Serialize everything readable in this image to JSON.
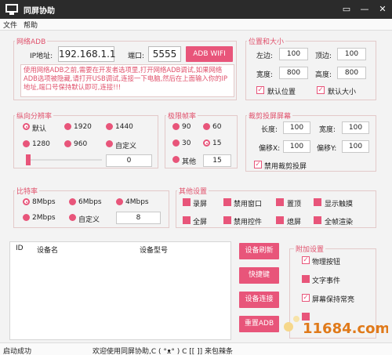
{
  "window": {
    "title": "同屏协助",
    "btn_pin": "▭",
    "btn_min": "—",
    "btn_close": "✕"
  },
  "menu": [
    "文件",
    "帮助"
  ],
  "adb": {
    "title": "网络ADB",
    "ip_label": "IP地址:",
    "ip_value": "192.168.1.1",
    "port_label": "端口:",
    "port_value": "5555",
    "button": "ADB WIFI",
    "notice": "使用网络ADB之前,需要在开发者选项里,打开网络ADB调试,如果网络ADB选项被隐藏,请打开USB调试,连接一下电脑,然后在上面输入你的IP地址,端口号保持默认即可,连接!!!"
  },
  "position": {
    "title": "位置和大小",
    "left_label": "左边:",
    "left_value": "100",
    "top_label": "顶边:",
    "top_value": "100",
    "width_label": "宽度:",
    "width_value": "800",
    "height_label": "高度:",
    "height_value": "800",
    "default_pos": "默认位置",
    "default_size": "默认大小"
  },
  "resolution": {
    "title": "纵向分辨率",
    "options": [
      "默认",
      "1920",
      "1440",
      "1280",
      "960",
      "自定义"
    ],
    "selected": 0,
    "slider_value": "0"
  },
  "fps": {
    "title": "极限帧率",
    "options": [
      "90",
      "60",
      "30",
      "15"
    ],
    "selected": 3,
    "other_label": "其他",
    "other_value": "15"
  },
  "crop": {
    "title": "裁剪投屏屏幕",
    "length_label": "长度:",
    "length_value": "100",
    "width_label": "宽度:",
    "width_value": "100",
    "offx_label": "偏移X:",
    "offx_value": "100",
    "offy_label": "偏移Y:",
    "offy_value": "100",
    "disable_label": "禁用裁剪投屏"
  },
  "bitrate": {
    "title": "比特率",
    "options": [
      "8Mbps",
      "6Mbps",
      "4Mbps",
      "2Mbps",
      "自定义"
    ],
    "selected": 0,
    "custom_value": "8"
  },
  "other": {
    "title": "其他设置",
    "options": [
      "录屏",
      "禁用窗口",
      "置顶",
      "显示触摸",
      "全屏",
      "禁用控件",
      "熄屏",
      "全帧渲染"
    ]
  },
  "devices": {
    "columns": [
      "ID",
      "设备名",
      "设备型号"
    ],
    "rows": []
  },
  "actions": [
    "设备刷新",
    "快捷键",
    "设备连接",
    "重置ADB"
  ],
  "extra": {
    "title": "附加设置",
    "options": [
      "物理按钮",
      "文字事件",
      "屏幕保持常亮",
      ""
    ],
    "checked": [
      true,
      false,
      true,
      false
    ]
  },
  "status": {
    "left": "启动成功",
    "right": "欢迎使用同屏协助,C ( °ᴥ° ) C [[ ]] 来包辣条"
  },
  "watermark": {
    "text": "11684.com"
  },
  "colors": {
    "accent": "#e8557a",
    "title_bg": "#2b2b2b",
    "group_title": "#e0506b"
  }
}
